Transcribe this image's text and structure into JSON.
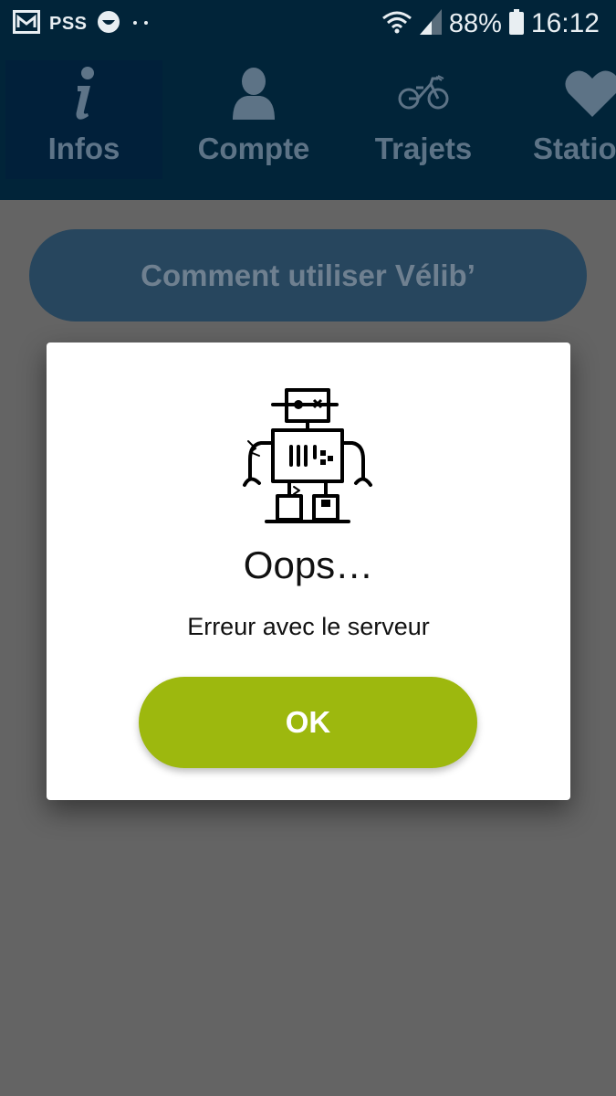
{
  "status_bar": {
    "carrier_label": "PSS",
    "battery_percent": "88%",
    "time": "16:12",
    "icons": [
      "gallery-icon",
      "face-icon",
      "dots-icon",
      "wifi-icon",
      "signal-icon",
      "battery-icon"
    ]
  },
  "tabs": [
    {
      "label": "Infos",
      "icon": "info-icon",
      "active": true
    },
    {
      "label": "Compte",
      "icon": "user-icon",
      "active": false
    },
    {
      "label": "Trajets",
      "icon": "bike-icon",
      "active": false
    },
    {
      "label": "Statio",
      "icon": "heart-icon",
      "active": false
    }
  ],
  "main": {
    "howto_button_label": "Comment utiliser Vélib’"
  },
  "dialog": {
    "icon": "robot-icon",
    "title": "Oops…",
    "message": "Erreur avec le serveur",
    "ok_label": "OK"
  },
  "colors": {
    "header_bg": "#012439",
    "tab_text": "#5d7386",
    "overlay_bg": "#646464",
    "howto_button": "#27465e",
    "ok_button": "#9db80e"
  }
}
